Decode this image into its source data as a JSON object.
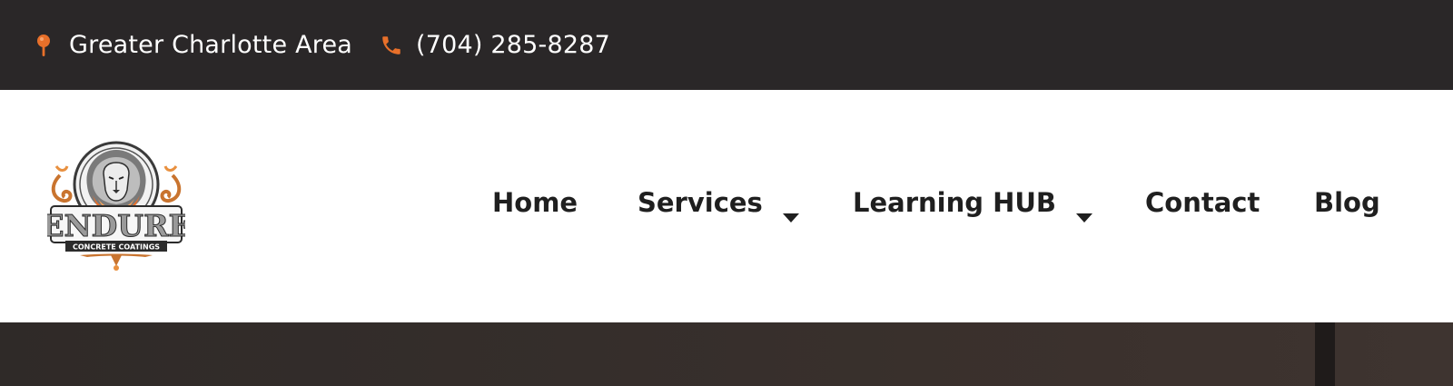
{
  "topbar": {
    "location_icon": "map-pin-icon",
    "location_text": "Greater Charlotte Area",
    "phone_icon": "phone-icon",
    "phone_text": "(704) 285-8287"
  },
  "brand": {
    "logo_icon": "endure-lion-logo",
    "name": "ENDURE",
    "tagline": "CONCRETE COATINGS"
  },
  "nav": {
    "items": [
      {
        "label": "Home"
      },
      {
        "label": "Services",
        "dropdown_icon": "caret-down-icon"
      },
      {
        "label": "Learning HUB",
        "dropdown_icon": "caret-down-icon"
      },
      {
        "label": "Contact"
      },
      {
        "label": "Blog"
      }
    ]
  },
  "colors": {
    "accent": "#e8702a",
    "topbar_bg": "#2a2728",
    "header_bg": "#ffffff",
    "nav_text": "#1f1f1f"
  }
}
